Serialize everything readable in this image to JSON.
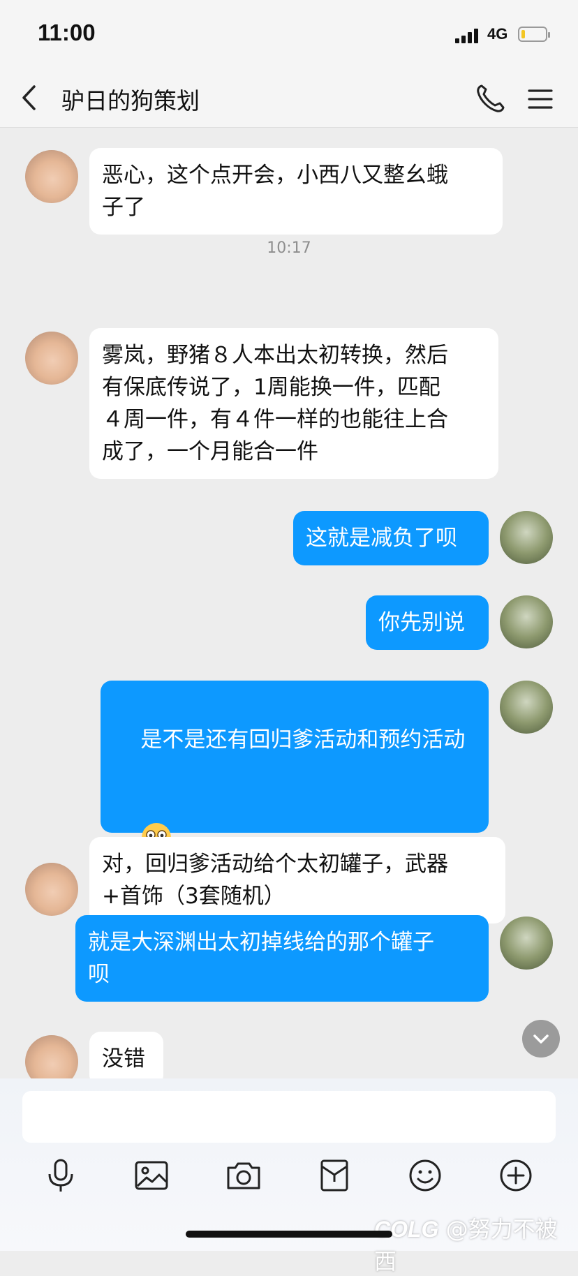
{
  "status_bar": {
    "time": "11:00",
    "network": "4G",
    "battery_color": "#f3c623"
  },
  "header": {
    "title": "驴日的狗策划",
    "icons": [
      "back-arrow-icon",
      "phone-icon",
      "menu-icon"
    ]
  },
  "messages": [
    {
      "side": "in",
      "text": "恶心，这个点开会，小西八又整幺蛾\n子了"
    },
    {
      "side": "in",
      "text": "雾岚，野猪８人本出太初转换，然后\n有保底传说了，1周能换一件，匹配\n４周一件，有４件一样的也能往上合\n成了，一个月能合一件"
    },
    {
      "side": "out",
      "text": "这就是减负了呗"
    },
    {
      "side": "out",
      "text": "你先别说"
    },
    {
      "side": "out",
      "text": "是不是还有回归爹活动和预约活动",
      "emoji": "peeking-face-emoji"
    },
    {
      "side": "in",
      "text": "对，回归爹活动给个太初罐子，武器\n+首饰（3套随机）"
    },
    {
      "side": "out",
      "text": "就是大深渊出太初掉线给的那个罐子\n呗"
    },
    {
      "side": "in",
      "text": "没错"
    }
  ],
  "timestamp": "10:17",
  "composer": {
    "input_value": "",
    "toolbar": [
      "microphone-icon",
      "image-icon",
      "camera-icon",
      "red-packet-icon",
      "emoji-icon",
      "plus-icon"
    ]
  },
  "watermark": {
    "logo": "COLG",
    "text": "@努力不被西"
  },
  "colors": {
    "outgoing_bubble": "#0d99ff",
    "incoming_bubble": "#ffffff",
    "background": "#ededed"
  }
}
